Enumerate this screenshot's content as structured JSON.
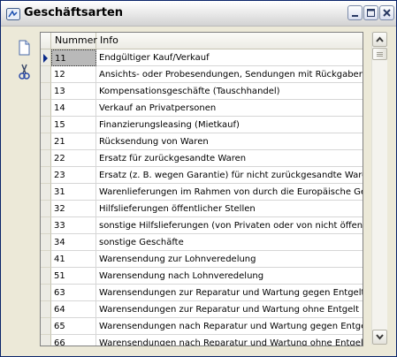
{
  "window": {
    "title": "Geschäftsarten"
  },
  "toolbar": {
    "new_icon": "document-new-icon",
    "cut_icon": "scissors-icon"
  },
  "grid": {
    "columns": [
      "Nummer",
      "Info"
    ],
    "selected_row": 0,
    "rows": [
      {
        "num": "11",
        "info": "Endgültiger Kauf/Verkauf"
      },
      {
        "num": "12",
        "info": "Ansichts- oder Probesendungen, Sendungen mit Rückgaberecht"
      },
      {
        "num": "13",
        "info": "Kompensationsgeschäfte (Tauschhandel)"
      },
      {
        "num": "14",
        "info": "Verkauf an Privatpersonen"
      },
      {
        "num": "15",
        "info": "Finanzierungsleasing (Mietkauf)"
      },
      {
        "num": "21",
        "info": "Rücksendung von Waren"
      },
      {
        "num": "22",
        "info": "Ersatz für zurückgesandte Waren"
      },
      {
        "num": "23",
        "info": "Ersatz (z. B. wegen Garantie) für nicht zurückgesandte Waren"
      },
      {
        "num": "31",
        "info": "Warenlieferungen im Rahmen von durch die Europäische Gemeinschaft"
      },
      {
        "num": "32",
        "info": "Hilfslieferungen öffentlicher Stellen"
      },
      {
        "num": "33",
        "info": "sonstige Hilfslieferungen (von Privaten oder von nicht öffentlichen"
      },
      {
        "num": "34",
        "info": "sonstige Geschäfte"
      },
      {
        "num": "41",
        "info": "Warensendung zur Lohnveredelung"
      },
      {
        "num": "51",
        "info": "Warensendung nach Lohnveredelung"
      },
      {
        "num": "63",
        "info": "Warensendungen zur Reparatur und Wartung gegen Entgelt"
      },
      {
        "num": "64",
        "info": "Warensendungen zur Reparatur und Wartung ohne Entgelt"
      },
      {
        "num": "65",
        "info": "Warensendungen nach Reparatur und Wartung gegen Entgelt"
      },
      {
        "num": "66",
        "info": "Warensendungen nach Reparatur und Wartung ohne Entgelt"
      }
    ]
  },
  "colors": {
    "title_border": "#0a246a",
    "selection": "#b9b9b9",
    "indicator_arrow": "#0b2a8a"
  }
}
